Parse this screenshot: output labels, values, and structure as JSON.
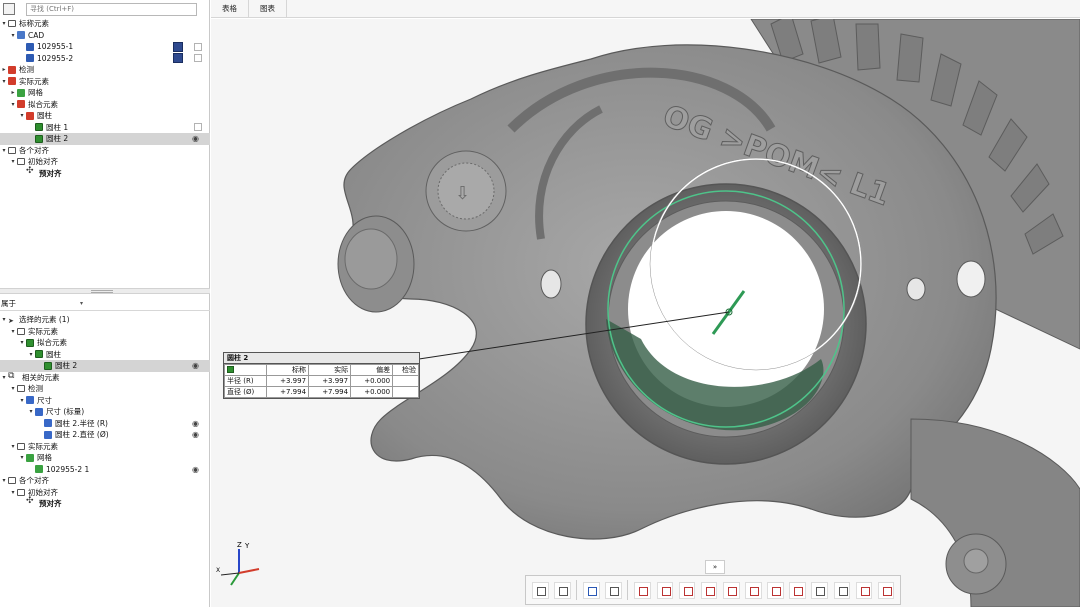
{
  "search": {
    "placeholder": "寻找 (Ctrl+F)"
  },
  "tabs": [
    "表格",
    "图表"
  ],
  "upper_tree": [
    {
      "label": "标称元素",
      "indent": 0,
      "tw": "▾",
      "icon": "folder"
    },
    {
      "label": "CAD",
      "indent": 1,
      "tw": "▾",
      "icon": "cad"
    },
    {
      "label": "102955-1",
      "indent": 2,
      "tw": "",
      "icon": "blue",
      "swatch": true,
      "checkbox": true
    },
    {
      "label": "102955-2",
      "indent": 2,
      "tw": "",
      "icon": "blue",
      "swatch": true,
      "checkbox": true
    },
    {
      "label": "检测",
      "indent": 0,
      "tw": "▸",
      "icon": "red"
    },
    {
      "label": "实际元素",
      "indent": 0,
      "tw": "▾",
      "icon": "red"
    },
    {
      "label": "网格",
      "indent": 1,
      "tw": "▸",
      "icon": "mesh"
    },
    {
      "label": "拟合元素",
      "indent": 1,
      "tw": "▾",
      "icon": "red"
    },
    {
      "label": "圆柱",
      "indent": 2,
      "tw": "▾",
      "icon": "red"
    },
    {
      "label": "圆柱 1",
      "indent": 3,
      "tw": "",
      "icon": "fit",
      "checkbox": true
    },
    {
      "label": "圆柱 2",
      "indent": 3,
      "tw": "",
      "icon": "fit",
      "eye": true,
      "selected": true
    },
    {
      "label": "各个对齐",
      "indent": 0,
      "tw": "▾",
      "icon": "folder"
    },
    {
      "label": "初始对齐",
      "indent": 1,
      "tw": "▾",
      "icon": "folder"
    },
    {
      "label": "预对齐",
      "indent": 2,
      "tw": "",
      "icon": "align",
      "bold": true
    }
  ],
  "filter": {
    "label": "属于",
    "arrow": "▾"
  },
  "collapse_label": "«",
  "lower_tree": [
    {
      "label": "选择的元素 (1)",
      "indent": 0,
      "tw": "▾",
      "icon": "cursor"
    },
    {
      "label": "实际元素",
      "indent": 1,
      "tw": "▾",
      "icon": "folder"
    },
    {
      "label": "拟合元素",
      "indent": 2,
      "tw": "▾",
      "icon": "fit"
    },
    {
      "label": "圆柱",
      "indent": 3,
      "tw": "▾",
      "icon": "fit"
    },
    {
      "label": "圆柱 2",
      "indent": 4,
      "tw": "",
      "icon": "fit",
      "eye": true,
      "selected": true
    },
    {
      "label": "相关的元素",
      "indent": 0,
      "tw": "▾",
      "icon": "rel"
    },
    {
      "label": "检测",
      "indent": 1,
      "tw": "▾",
      "icon": "folder"
    },
    {
      "label": "尺寸",
      "indent": 2,
      "tw": "▾",
      "icon": "dim"
    },
    {
      "label": "尺寸 (标量)",
      "indent": 3,
      "tw": "▾",
      "icon": "dim"
    },
    {
      "label": "圆柱 2.半径 (R)",
      "indent": 4,
      "tw": "",
      "icon": "dim",
      "eye": true
    },
    {
      "label": "圆柱 2.直径 (Ø)",
      "indent": 4,
      "tw": "",
      "icon": "dim",
      "eye": true
    },
    {
      "label": "实际元素",
      "indent": 1,
      "tw": "▾",
      "icon": "folder"
    },
    {
      "label": "网格",
      "indent": 2,
      "tw": "▾",
      "icon": "mesh"
    },
    {
      "label": "102955-2 1",
      "indent": 3,
      "tw": "",
      "icon": "mesh",
      "eye": true
    },
    {
      "label": "各个对齐",
      "indent": 0,
      "tw": "▾",
      "icon": "folder"
    },
    {
      "label": "初始对齐",
      "indent": 1,
      "tw": "▾",
      "icon": "folder"
    },
    {
      "label": "预对齐",
      "indent": 2,
      "tw": "",
      "icon": "align",
      "bold": true
    }
  ],
  "callout": {
    "title": "圆柱 2",
    "headers": [
      "标称",
      "实际",
      "偏差",
      "检验"
    ],
    "rows": [
      {
        "name": "半径 (R)",
        "nominal": "+3.997",
        "actual": "+3.997",
        "deviation": "+0.000",
        "check": ""
      },
      {
        "name": "直径 (Ø)",
        "nominal": "+7.994",
        "actual": "+7.994",
        "deviation": "+0.000",
        "check": ""
      }
    ]
  },
  "part_text": "OG >POM< L1",
  "expander_label": "»",
  "axes": {
    "z": "Z",
    "y": "Y",
    "x": "X"
  },
  "colors": {
    "selection": "#d4d4d4",
    "part": "#8e8e8e",
    "highlight": "#2e9a55",
    "cad_swatch": "#2f4a8f"
  }
}
